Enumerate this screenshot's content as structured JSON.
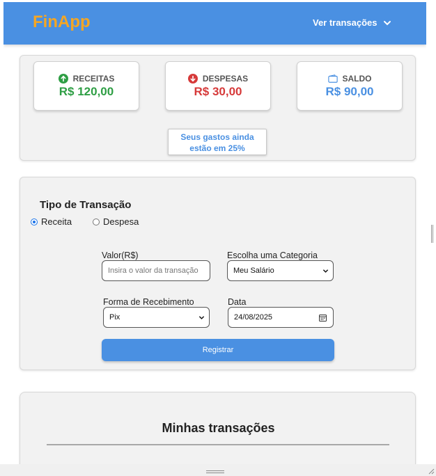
{
  "app": {
    "brand": "FinApp",
    "nav_link": "Ver transações"
  },
  "summary": {
    "income": {
      "label": "RECEITAS",
      "value": "R$ 120,00"
    },
    "expenses": {
      "label": "DESPESAS",
      "value": "R$ 30,00"
    },
    "balance": {
      "label": "SALDO",
      "value": "R$ 90,00"
    },
    "hint_line1": "Seus gastos ainda",
    "hint_line2": "estão em 25%"
  },
  "form": {
    "title": "Tipo de Transação",
    "type_income": "Receita",
    "type_expense": "Despesa",
    "selected_type": "Receita",
    "value_label": "Valor(R$)",
    "value_placeholder": "Insira o valor da transação",
    "category_label": "Escolha uma Categoria",
    "category_value": "Meu Salário",
    "method_label": "Forma de Recebimento",
    "method_value": "Pix",
    "date_label": "Data",
    "date_value": "24/08/2025",
    "submit_label": "Registrar"
  },
  "transactions": {
    "title": "Minhas transações"
  },
  "colors": {
    "navbar": "#4a90e2",
    "brand": "#f5a623",
    "income": "#2e9e44",
    "expense": "#d63a3a",
    "balance": "#4a90e2"
  },
  "icons": {
    "nav": "chevron-down-icon",
    "income": "arrow-up-circle-icon",
    "expense": "arrow-down-circle-icon",
    "balance": "wallet-icon",
    "select": "chevron-down-icon",
    "date": "calendar-icon"
  }
}
